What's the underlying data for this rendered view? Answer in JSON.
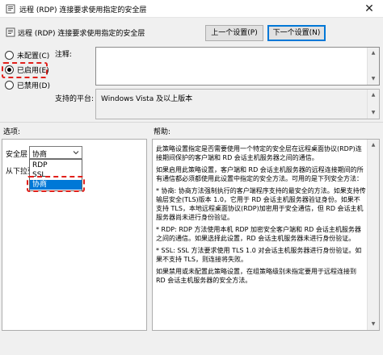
{
  "window": {
    "title": "远程 (RDP) 连接要求使用指定的安全层",
    "close_glyph": "✕"
  },
  "header": {
    "policy_name": "远程 (RDP) 连接要求使用指定的安全层"
  },
  "nav": {
    "prev_label": "上一个设置(P)",
    "next_label": "下一个设置(N)"
  },
  "state": {
    "not_configured": "未配置(C)",
    "enabled": "已启用(E)",
    "disabled": "已禁用(D)",
    "selected": "enabled"
  },
  "comment": {
    "label": "注释:",
    "value": ""
  },
  "platform": {
    "label": "支持的平台:",
    "value": "Windows Vista 及以上版本"
  },
  "options": {
    "section_label": "选项:",
    "security_layer_label": "安全层",
    "security_layer_value": "协商",
    "dropdown_items": [
      "RDP",
      "SSL",
      "协商"
    ],
    "dropdown_selected_index": 2,
    "hint_text": "从下拉列"
  },
  "help": {
    "section_label": "帮助:",
    "paragraphs": [
      "此策略设置指定是否需要使用一个特定的安全层在远程桌面协议(RDP)连接期间保护的客户端和 RD 会话主机服务器之间的通信。",
      "如果启用此策略设置，客户端和 RD 会话主机服务器的远程连接期间的所有通信都必须都使用此设置中指定的安全方法。可用的是下列安全方法：",
      "* 协商: 协商方法强制执行的客户端程序支持的最安全的方法。如果支持传输层安全(TLS)版本 1.0，它用于 RD 会话主机服务器验证身份。如果不支持 TLS，本地远程桌面协议(RDP)加密用于安全通信，但 RD 会话主机服务器尚未进行身份验证。",
      "* RDP: RDP 方法使用本机 RDP 加密安全客户端和 RD 会话主机服务器之间的通信。如果选择此设置，RD 会话主机服务器未进行身份验证。",
      "* SSL: SSL 方法要求使用 TLS 1.0 对会话主机服务器进行身份验证。如果不支持 TLS，则连接将失败。",
      "如果禁用或未配置此策略设置，在组策略级别未指定要用于远程连接到 RD 会话主机服务器的安全方法。"
    ]
  },
  "colors": {
    "annotation_red": "#e0201b",
    "selection_blue": "#0078d7"
  }
}
